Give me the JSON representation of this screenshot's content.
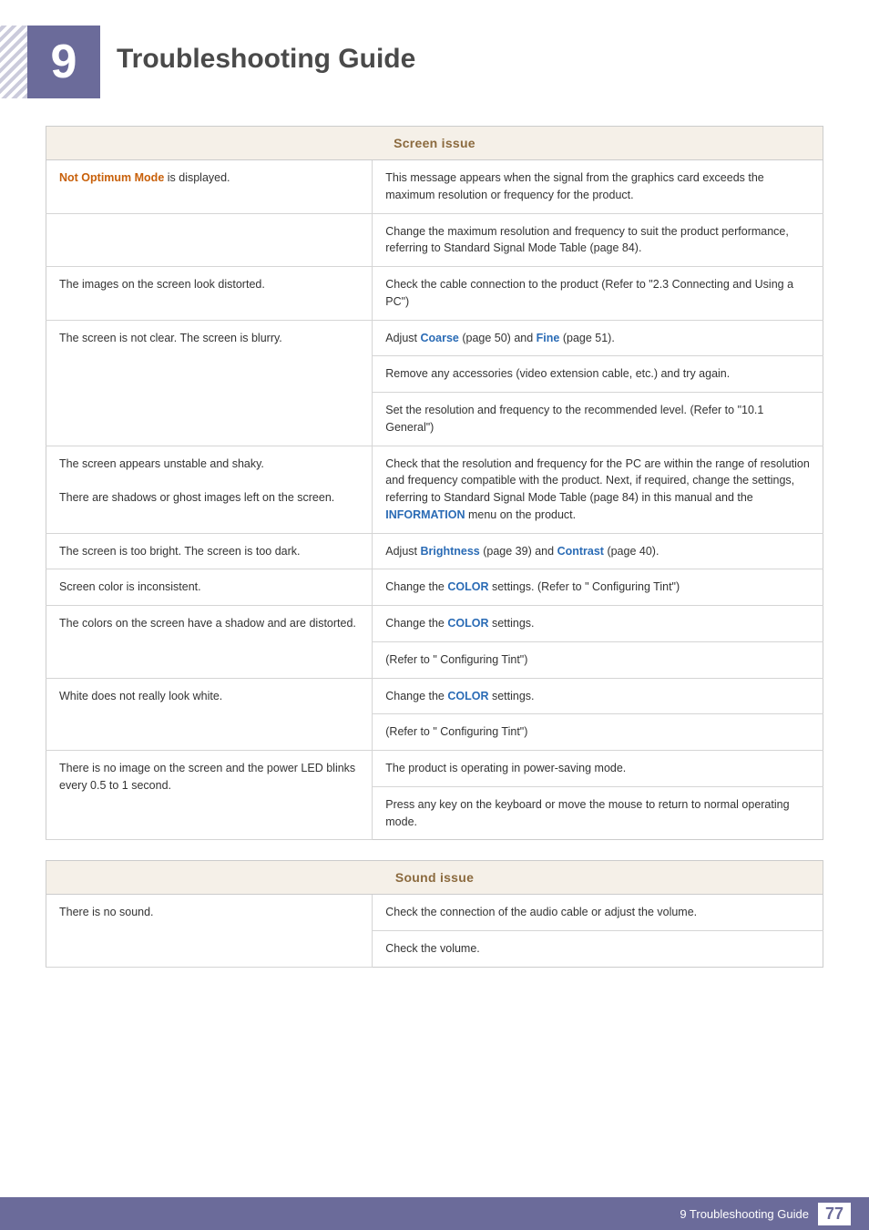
{
  "chapter": {
    "number": "9",
    "title": "Troubleshooting Guide"
  },
  "screen_issue": {
    "header": "Screen issue",
    "rows": [
      {
        "problem": "Not Optimum Mode is displayed.",
        "problem_has_highlight": true,
        "highlight_text": "Not Optimum Mode",
        "highlight_color": "orange",
        "solution": "This message appears when the signal from the graphics card exceeds the maximum resolution or frequency for the product."
      },
      {
        "problem": "",
        "solution": "Change the maximum resolution and frequency to suit the product performance, referring to Standard Signal Mode Table (page 84)."
      },
      {
        "problem": "The images on the screen look distorted.",
        "solution": "Check the cable connection to the product (Refer to \"2.3 Connecting and Using a PC\")"
      },
      {
        "problem": "The screen is not clear. The screen is blurry.",
        "solution_parts": [
          {
            "text": "Adjust ",
            "highlight": "Coarse",
            "highlight_color": "blue",
            "after": " (page 50) and ",
            "highlight2": "Fine",
            "highlight2_color": "blue",
            "after2": " (page 51)."
          },
          {
            "plain": "Remove any accessories (video extension cable, etc.) and try again."
          },
          {
            "plain": "Set the resolution and frequency to the recommended level. (Refer to \"10.1 General\")"
          }
        ]
      },
      {
        "problem": "The screen appears unstable and shaky.",
        "problem2": "There are shadows or ghost images left on the screen.",
        "solution": "Check that the resolution and frequency for the PC are within the range of resolution and frequency compatible with the product. Next, if required, change the settings, referring to Standard Signal Mode Table (page 84) in this manual and the INFORMATION menu on the product.",
        "solution_highlight": "INFORMATION",
        "solution_highlight_color": "blue"
      },
      {
        "problem": "The screen is too bright. The screen is too dark.",
        "solution": "Adjust Brightness (page 39) and Contrast (page 40).",
        "solution_highlights": [
          {
            "word": "Brightness",
            "color": "blue"
          },
          {
            "word": "Contrast",
            "color": "blue"
          }
        ]
      },
      {
        "problem": "Screen color is inconsistent.",
        "solution": "Change the COLOR settings. (Refer to \" Configuring Tint\")",
        "solution_highlight": "COLOR",
        "solution_highlight_color": "blue"
      },
      {
        "problem": "The colors on the screen have a shadow and are distorted.",
        "solution1": "Change the COLOR settings.",
        "solution2": "(Refer to \" Configuring Tint\")",
        "highlight": "COLOR",
        "highlight_color": "blue"
      },
      {
        "problem": "White does not really look white.",
        "solution1": "Change the COLOR settings.",
        "solution2": "(Refer to \" Configuring Tint\")",
        "highlight": "COLOR",
        "highlight_color": "blue"
      },
      {
        "problem": "There is no image on the screen and the power LED blinks every 0.5 to 1 second.",
        "solution1": "The product is operating in power-saving mode.",
        "solution2": "Press any key on the keyboard or move the mouse to return to normal operating mode."
      }
    ]
  },
  "sound_issue": {
    "header": "Sound issue",
    "rows": [
      {
        "problem": "There is no sound.",
        "solution1": "Check the connection of the audio cable or adjust the volume.",
        "solution2": "Check the volume."
      }
    ]
  },
  "footer": {
    "text": "9 Troubleshooting Guide",
    "page": "77"
  }
}
